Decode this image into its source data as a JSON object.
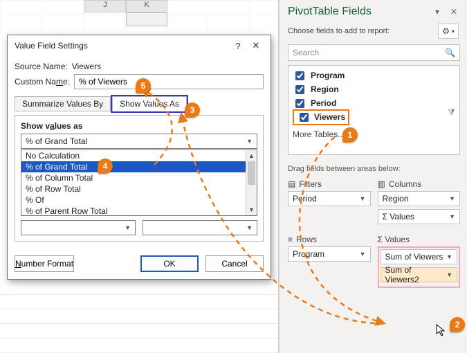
{
  "sheet": {
    "colJ": "J",
    "colK": "K"
  },
  "dialog": {
    "title": "Value Field Settings",
    "source_label": "Source Name:",
    "source_name": "Viewers",
    "custom_label": "Custom Name:",
    "custom_name": "% of Viewers",
    "tab_summarize": "Summarize Values By",
    "tab_show": "Show Values As",
    "show_values_label": "Show values as",
    "combo_value": "% of Grand Total",
    "list": [
      "No Calculation",
      "% of Grand Total",
      "% of Column Total",
      "% of Row Total",
      "% Of",
      "% of Parent Row Total"
    ],
    "number_format": "Number Format",
    "ok": "OK",
    "cancel": "Cancel",
    "help": "?",
    "close": "✕"
  },
  "pane": {
    "title": "PivotTable Fields",
    "subtitle": "Choose fields to add to report:",
    "search_placeholder": "Search",
    "fields": {
      "program": "Program",
      "region": "Region",
      "period": "Period",
      "viewers": "Viewers"
    },
    "more": "More Tables...",
    "drag": "Drag fields between areas below:",
    "filters": {
      "label": "Filters",
      "chip": "Period"
    },
    "columns": {
      "label": "Columns",
      "chip1": "Region",
      "chip2": "Σ Values"
    },
    "rows": {
      "label": "Rows",
      "chip": "Program"
    },
    "values": {
      "label": "Σ  Values",
      "chip1": "Sum of Viewers",
      "chip2": "Sum of Viewers2"
    }
  },
  "annotations": {
    "a1": "1",
    "a2": "2",
    "a3": "3",
    "a4": "4",
    "a5": "5"
  }
}
